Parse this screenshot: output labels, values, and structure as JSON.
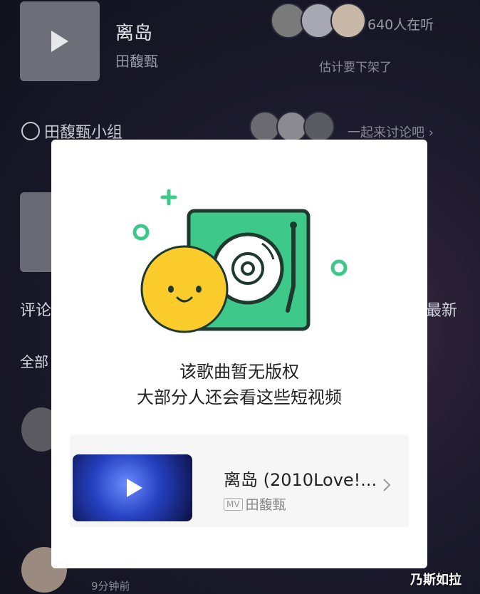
{
  "song": {
    "title": "离岛",
    "artist": "田馥甄"
  },
  "listeners": {
    "count_text": "640人在听",
    "comment_hint": "估计要下架了"
  },
  "group": {
    "name": "田馥甄小组",
    "discuss_text": "一起来讨论吧"
  },
  "comments": {
    "tab_label": "评论",
    "sort_newest": "最新",
    "all_label": "全部",
    "time_ago": "9分钟前"
  },
  "modal": {
    "title": "该歌曲暂无版权",
    "subtitle": "大部分人还会看这些短视频",
    "video": {
      "title": "离岛 (2010Love!...",
      "badge": "MV",
      "artist": "田馥甄"
    }
  },
  "watermark": "乃斯如拉",
  "colors": {
    "accent_green": "#3ec98a",
    "smiley_yellow": "#fccc2c",
    "dark_stroke": "#1e3a2e"
  }
}
